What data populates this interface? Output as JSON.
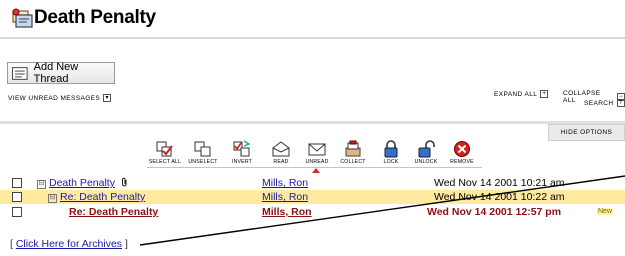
{
  "header": {
    "title": "Death Penalty",
    "icon": "forum-icon"
  },
  "actions": {
    "add_thread_label": "Add New Thread",
    "view_unread_label": "VIEW UNREAD MESSAGES",
    "expand_all_label": "EXPAND ALL",
    "collapse_all_label": "COLLAPSE ALL",
    "search_label": "SEARCH",
    "hide_options_label": "HIDE OPTIONS"
  },
  "toolbar": [
    {
      "label": "SELECT ALL",
      "icon": "select-all-icon"
    },
    {
      "label": "UNSELECT",
      "icon": "unselect-icon"
    },
    {
      "label": "INVERT",
      "icon": "invert-icon"
    },
    {
      "label": "READ",
      "icon": "read-icon"
    },
    {
      "label": "UNREAD",
      "icon": "unread-icon"
    },
    {
      "label": "COLLECT",
      "icon": "collect-icon"
    },
    {
      "label": "LOCK",
      "icon": "lock-icon"
    },
    {
      "label": "UNLOCK",
      "icon": "unlock-icon"
    },
    {
      "label": "REMOVE",
      "icon": "remove-icon"
    }
  ],
  "threads": [
    {
      "subject": "Death Penalty",
      "author": "Mills, Ron",
      "date": "Wed Nov 14 2001 10:21 am",
      "toggle": "⊟",
      "badge": ""
    },
    {
      "subject": "Re: Death Penalty",
      "author": "Mills, Ron",
      "date": "Wed Nov 14 2001 10:22 am",
      "toggle": "⊟",
      "badge": ""
    },
    {
      "subject": "Re: Death Penalty",
      "author": "Mills, Ron",
      "date": "Wed Nov 14 2001 12:57 pm",
      "toggle": "",
      "badge": "New"
    }
  ],
  "footer": {
    "archives_prefix": "[ ",
    "archives_link": "Click Here for Archives",
    "archives_suffix": " ]"
  },
  "colors": {
    "highlight_row": "#ffeaa0",
    "highlight_bar": "#ffcc2e",
    "new_post": "#8b1111",
    "link": "#1a1aa6"
  }
}
